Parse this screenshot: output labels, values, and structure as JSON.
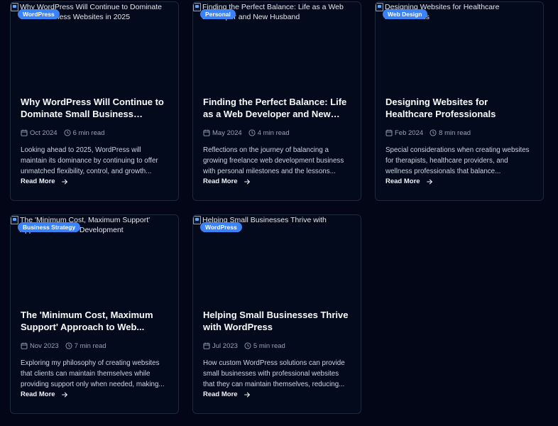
{
  "posts": [
    {
      "image_alt": "Why WordPress Will Continue to Dominate Small Business Websites in 2025",
      "category": "WordPress",
      "title": "Why WordPress Will Continue to Dominate Small Business Website...",
      "date": "Oct 2024",
      "read_time": "6 min read",
      "excerpt": "Looking ahead to 2025, WordPress will maintain its dominance by continuing to offer unmatched flexibility, control, and growth...",
      "cta": "Read More"
    },
    {
      "image_alt": "Finding the Perfect Balance: Life as a Web Developer and New Husband",
      "category": "Personal",
      "title": "Finding the Perfect Balance: Life as a Web Developer and New Husband",
      "date": "May 2024",
      "read_time": "4 min read",
      "excerpt": "Reflections on the journey of balancing a growing freelance web development business with personal milestones and the lessons...",
      "cta": "Read More"
    },
    {
      "image_alt": "Designing Websites for Healthcare Professionals",
      "category": "Web Design",
      "title": "Designing Websites for Healthcare Professionals",
      "date": "Feb 2024",
      "read_time": "8 min read",
      "excerpt": "Special considerations when creating websites for therapists, healthcare providers, and wellness professionals that balance...",
      "cta": "Read More"
    },
    {
      "image_alt": "The 'Minimum Cost, Maximum Support' Approach to Web Development",
      "category": "Business Strategy",
      "title": "The 'Minimum Cost, Maximum Support' Approach to Web...",
      "date": "Nov 2023",
      "read_time": "7 min read",
      "excerpt": "Exploring my philosophy of creating websites that clients can maintain themselves while providing support only when needed, making...",
      "cta": "Read More"
    },
    {
      "image_alt": "Helping Small Businesses Thrive with WordPress",
      "category": "WordPress",
      "title": "Helping Small Businesses Thrive with WordPress",
      "date": "Jul 2023",
      "read_time": "5 min read",
      "excerpt": "How custom WordPress solutions can provide small businesses with professional websites that they can maintain themselves, reducing...",
      "cta": "Read More"
    }
  ],
  "icons": {
    "date": "calendar-icon",
    "read_time": "clock-icon",
    "cta": "arrow-right-icon",
    "image": "broken-image-icon"
  },
  "colors": {
    "background": "#020617",
    "badge": "#3b82f6",
    "card_border": "#1e293b"
  }
}
